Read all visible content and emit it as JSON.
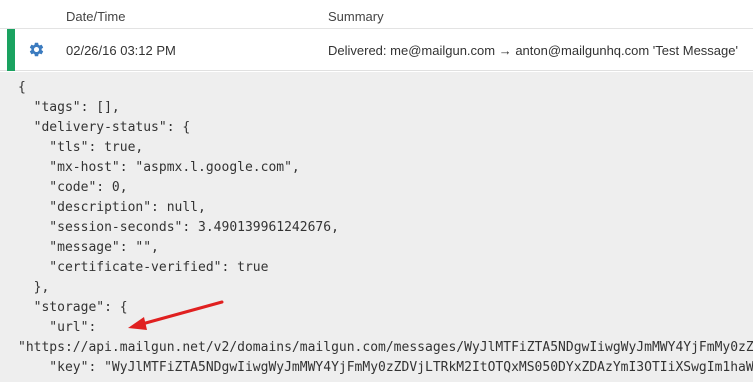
{
  "header": {
    "datetime_label": "Date/Time",
    "summary_label": "Summary"
  },
  "event": {
    "status_color": "#1aa260",
    "icon": "gear-icon",
    "datetime": "02/26/16 03:12 PM",
    "summary": "Delivered: me@mailgun.com → anton@mailgunhq.com 'Test Message'"
  },
  "json_lines": [
    "{",
    "  \"tags\": [],",
    "  \"delivery-status\": {",
    "    \"tls\": true,",
    "    \"mx-host\": \"aspmx.l.google.com\",",
    "    \"code\": 0,",
    "    \"description\": null,",
    "    \"session-seconds\": 3.490139961242676,",
    "    \"message\": \"\",",
    "    \"certificate-verified\": true",
    "  },",
    "  \"storage\": {",
    "    \"url\":",
    "\"https://api.mailgun.net/v2/domains/mailgun.com/messages/WyJlMTFiZTA5NDgwIiwgWyJmMWY4YjFmMy0zZ",
    "    \"key\": \"WyJlMTFiZTA5NDgwIiwgWyJmMWY4YjFmMy0zZDVjLTRkM2ItOTQxMS050DYxZDAzYmI3OTIiXSwgIm1haW"
  ],
  "annotation": {
    "arrow_color": "#e02020"
  }
}
